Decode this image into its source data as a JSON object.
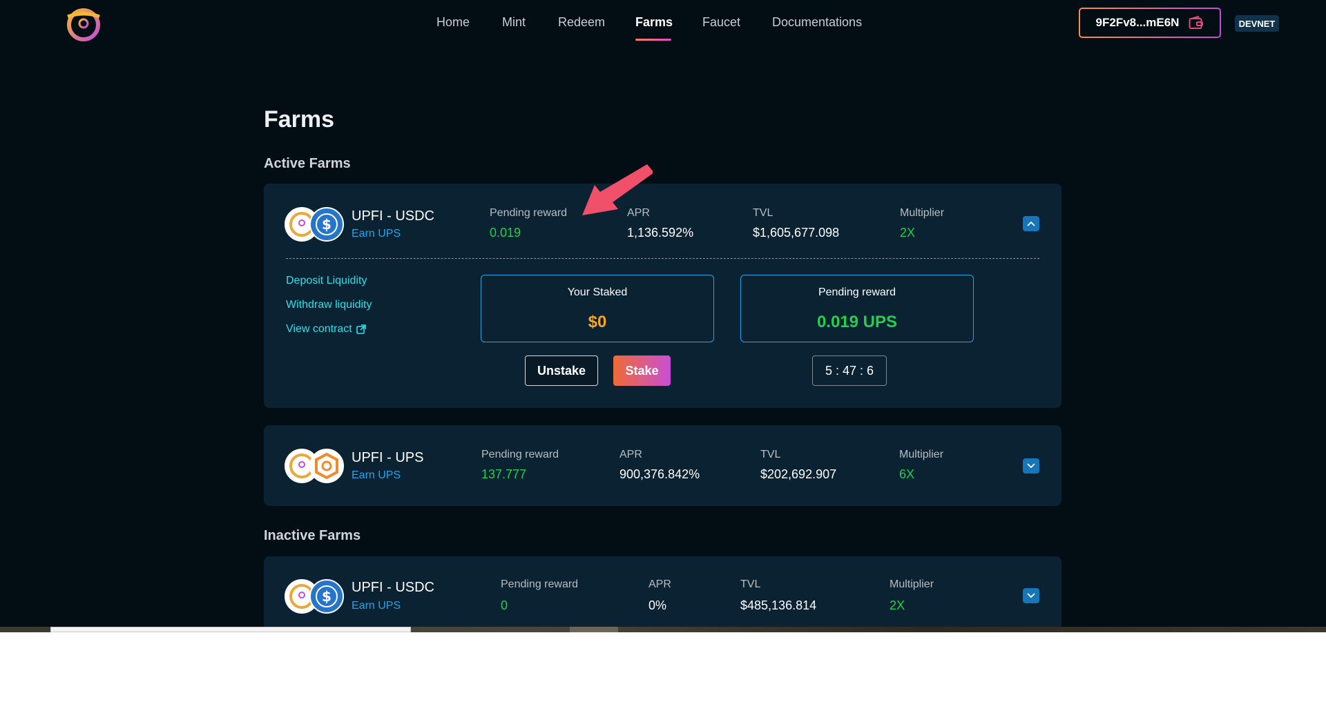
{
  "nav": {
    "links": [
      "Home",
      "Mint",
      "Redeem",
      "Farms",
      "Faucet",
      "Documentations"
    ],
    "active": "Farms",
    "wallet_address": "9F2Fv8...mE6N",
    "network": "DEVNET"
  },
  "page": {
    "title": "Farms",
    "active_section": "Active Farms",
    "inactive_section": "Inactive Farms"
  },
  "labels": {
    "pending_reward": "Pending reward",
    "apr": "APR",
    "tvl": "TVL",
    "multiplier": "Multiplier"
  },
  "farms": [
    {
      "pair": "UPFI - USDC",
      "earn": "Earn UPS",
      "pending_reward": "0.019",
      "apr": "1,136.592%",
      "tvl": "$1,605,677.098",
      "multiplier": "2X",
      "expanded": true,
      "details": {
        "links": [
          "Deposit Liquidity",
          "Withdraw liquidity",
          "View contract"
        ],
        "your_staked_label": "Your Staked",
        "your_staked_value": "$0",
        "pending_reward_label": "Pending reward",
        "pending_reward_value": "0.019 UPS",
        "unstake_label": "Unstake",
        "stake_label": "Stake",
        "timer": "5 : 47 : 6"
      }
    },
    {
      "pair": "UPFI - UPS",
      "earn": "Earn UPS",
      "pending_reward": "137.777",
      "apr": "900,376.842%",
      "tvl": "$202,692.907",
      "multiplier": "6X",
      "expanded": false
    },
    {
      "pair": "UPFI - USDC",
      "earn": "Earn UPS",
      "pending_reward": "0",
      "apr": "0%",
      "tvl": "$485,136.814",
      "multiplier": "2X",
      "expanded": false
    }
  ],
  "colors": {
    "background": "#030e14",
    "card": "#0b2232",
    "accent_green": "#22d04f",
    "accent_blue": "#2aa4e6",
    "accent_cyan": "#2ee1e6",
    "accent_orange": "#f5a623",
    "annotation_arrow": "#f0506a"
  },
  "icons": {
    "logo": "steering-wheel-logo",
    "wallet": "wallet-icon",
    "external": "external-link-icon",
    "chevron_up": "chevron-up-icon",
    "chevron_down": "chevron-down-icon"
  }
}
